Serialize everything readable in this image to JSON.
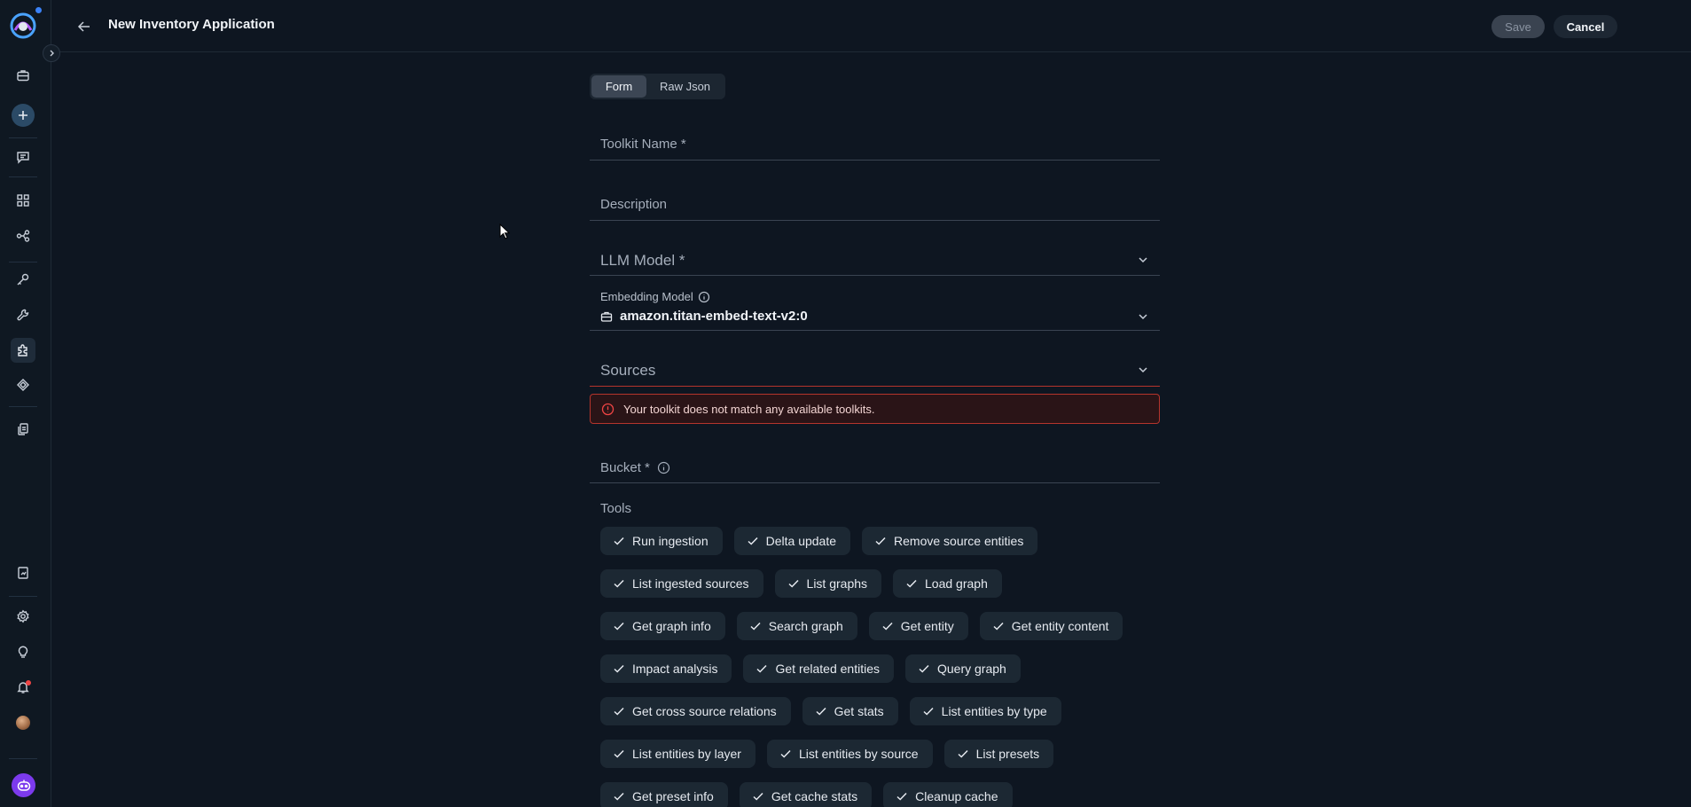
{
  "header": {
    "title": "New Inventory Application",
    "save_label": "Save",
    "cancel_label": "Cancel"
  },
  "sidebar": {
    "items": [
      {
        "icon": "briefcase-icon"
      },
      {
        "icon": "plus-icon"
      },
      {
        "icon": "chat-icon"
      },
      {
        "icon": "grid-icon"
      },
      {
        "icon": "flow-icon"
      },
      {
        "icon": "key-icon"
      },
      {
        "icon": "wrench-icon"
      },
      {
        "icon": "puzzle-icon"
      },
      {
        "icon": "layers-icon"
      },
      {
        "icon": "documents-icon"
      },
      {
        "icon": "report-icon"
      },
      {
        "icon": "settings-icon"
      },
      {
        "icon": "lightbulb-icon"
      },
      {
        "icon": "bell-icon"
      },
      {
        "icon": "avatar"
      },
      {
        "icon": "assistant-bot-icon"
      }
    ]
  },
  "form": {
    "mode_tabs": [
      "Form",
      "Raw Json"
    ],
    "toolkit_name_label": "Toolkit Name *",
    "description_label": "Description",
    "llm_model_label": "LLM Model *",
    "embedding_model_label": "Embedding Model",
    "embedding_model_value": "amazon.titan-embed-text-v2:0",
    "sources_label": "Sources",
    "error_message": "Your toolkit does not match any available toolkits.",
    "bucket_label": "Bucket *",
    "tools_label": "Tools",
    "tools": [
      [
        "Run ingestion",
        "Delta update",
        "Remove source entities"
      ],
      [
        "List ingested sources",
        "List graphs",
        "Load graph"
      ],
      [
        "Get graph info",
        "Search graph",
        "Get entity",
        "Get entity content"
      ],
      [
        "Impact analysis",
        "Get related entities",
        "Query graph"
      ],
      [
        "Get cross source relations",
        "Get stats",
        "List entities by type"
      ],
      [
        "List entities by layer",
        "List entities by source",
        "List presets"
      ],
      [
        "Get preset info",
        "Get cache stats",
        "Cleanup cache"
      ]
    ]
  },
  "colors": {
    "background": "#0e1621",
    "error_border": "#b5342c",
    "accent_bot": "#7c3aed",
    "notification_dot": "#ef4444"
  }
}
